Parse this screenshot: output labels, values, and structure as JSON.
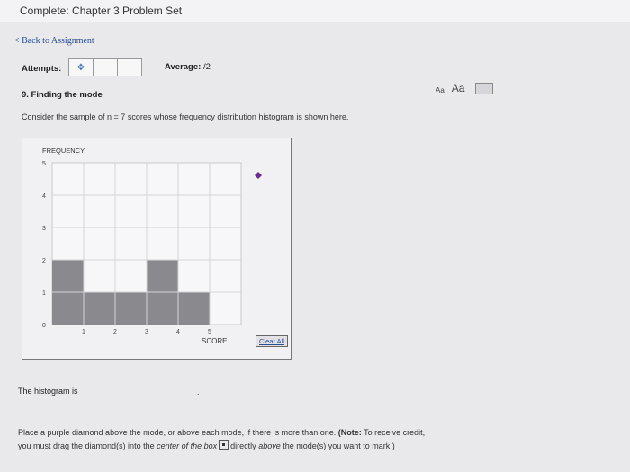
{
  "header": {
    "title": "Complete: Chapter 3 Problem Set"
  },
  "nav": {
    "back_label": "< Back to Assignment"
  },
  "attempts": {
    "label": "Attempts:",
    "icon": "dot-icon"
  },
  "average": {
    "label": "Average:",
    "value": "/2"
  },
  "question": {
    "title": "9. Finding the mode",
    "intro": "Consider the sample of n = 7 scores whose frequency distribution histogram is shown here."
  },
  "font_controls": {
    "small": "Aa",
    "large": "Aa",
    "print_icon": "print-icon"
  },
  "chart_data": {
    "type": "bar",
    "ylabel": "FREQUENCY",
    "xlabel": "SCORE",
    "categories": [
      "1",
      "2",
      "3",
      "4",
      "5"
    ],
    "values": [
      2,
      1,
      1,
      2,
      1
    ],
    "ylim": [
      0,
      5
    ],
    "yticks": [
      "0",
      "1",
      "2",
      "3",
      "4",
      "5"
    ],
    "grid": true,
    "bar_color": "#8a8a8e",
    "marker": {
      "shape": "diamond",
      "color": "#6a2c8e"
    }
  },
  "clear_label": "Clear All",
  "answer": {
    "prefix": "The histogram is",
    "suffix": "."
  },
  "instructions": {
    "line1_a": "Place a purple diamond above the mode, or above each mode, if there is more than one.",
    "note_label": "(Note:",
    "line1_b": "To receive credit,",
    "line2_a": "you must drag the diamond(s) into the",
    "line2_italic": "center of the box",
    "line2_b": "directly",
    "line2_italic2": "above",
    "line2_c": "the mode(s) you want to mark.)"
  }
}
